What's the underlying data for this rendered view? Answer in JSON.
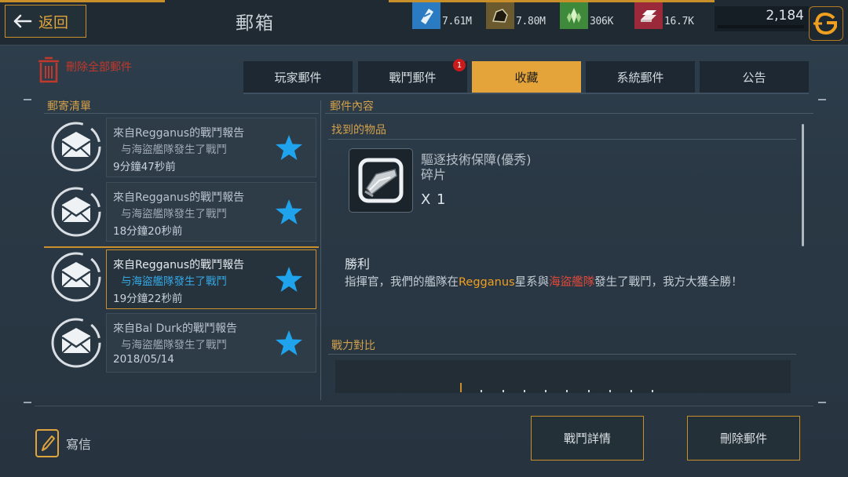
{
  "header": {
    "back_label": "返回",
    "title": "郵箱",
    "resources": [
      {
        "name": "crystal-bag",
        "value": "7.61M",
        "color": "#2a7bc2"
      },
      {
        "name": "ore",
        "value": "7.80M",
        "color": "#6b5a2e"
      },
      {
        "name": "mineral",
        "value": "306K",
        "color": "#3f8a3a"
      },
      {
        "name": "ingot",
        "value": "16.7K",
        "color": "#9a2a3a"
      }
    ],
    "credits": "2,184"
  },
  "toolbar": {
    "delete_all_label": "刪除全部郵件"
  },
  "tabs": [
    {
      "label": "玩家郵件"
    },
    {
      "label": "戰鬥郵件",
      "badge": "1"
    },
    {
      "label": "收藏",
      "active": true
    },
    {
      "label": "系統郵件"
    },
    {
      "label": "公告"
    }
  ],
  "mail_list": {
    "title": "郵寄清單",
    "items": [
      {
        "from": "來自Regganus的戰鬥報告",
        "subject": "与海盜艦隊發生了戰鬥",
        "time": "9分鐘47秒前",
        "selected": false
      },
      {
        "from": "來自Regganus的戰鬥報告",
        "subject": "与海盜艦隊發生了戰鬥",
        "time": "18分鐘20秒前",
        "selected": false
      },
      {
        "from": "來自Regganus的戰鬥報告",
        "subject": "与海盜艦隊發生了戰鬥",
        "time": "19分鐘22秒前",
        "selected": true
      },
      {
        "from": "來自Bal Durk的戰鬥報告",
        "subject": "与海盜艦隊發生了戰鬥",
        "time": "2018/05/14",
        "selected": false
      }
    ]
  },
  "detail": {
    "title": "郵件內容",
    "found_items_label": "找到的物品",
    "item": {
      "name_line1": "驅逐技術保障(優秀)",
      "name_line2": "碎片",
      "qty": "X 1"
    },
    "result_title": "勝利",
    "body_prefix": "指揮官，我們的艦隊在",
    "body_system": "Regganus",
    "body_mid": "星系與",
    "body_enemy": "海盜艦隊",
    "body_suffix": "發生了戰鬥，我方大獲全勝！",
    "power_label": "戰力對比"
  },
  "footer": {
    "write_label": "寫信",
    "battle_details_label": "戰鬥詳情",
    "delete_mail_label": "刪除郵件"
  }
}
